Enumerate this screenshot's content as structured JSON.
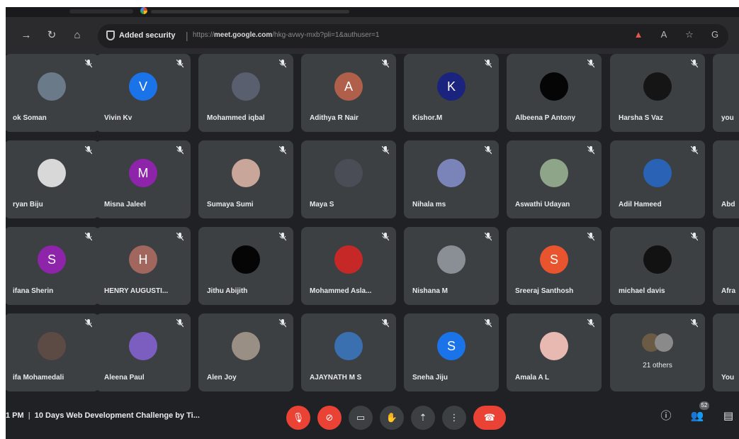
{
  "browser": {
    "security_label": "Added security",
    "url_domain": "meet.google.com",
    "url_rest": "/hkg-avwy-mxb?pli=1&authuser=1",
    "url_prefix": "https://"
  },
  "participants": [
    {
      "name": "ok Soman",
      "avatar": "photo",
      "color": "#6b7a88"
    },
    {
      "name": "Vivin Kv",
      "avatar": "letter",
      "letter": "V",
      "color": "#1a73e8"
    },
    {
      "name": "Mohammed iqbal",
      "avatar": "photo",
      "color": "#5a5f70"
    },
    {
      "name": "Adithya R Nair",
      "avatar": "letter",
      "letter": "A",
      "color": "#b0604a"
    },
    {
      "name": "Kishor.M",
      "avatar": "letter",
      "letter": "K",
      "color": "#1a237e"
    },
    {
      "name": "Albeena P Antony",
      "avatar": "photo",
      "color": "#050505"
    },
    {
      "name": "Harsha S Vaz",
      "avatar": "photo",
      "color": "#151515"
    },
    {
      "name": "you",
      "avatar": "none",
      "color": "#3c4043"
    },
    {
      "name": "ryan Biju",
      "avatar": "photo",
      "color": "#d8d8d8"
    },
    {
      "name": "Misna Jaleel",
      "avatar": "letter",
      "letter": "M",
      "color": "#8e24aa"
    },
    {
      "name": "Sumaya Sumi",
      "avatar": "photo",
      "color": "#c9a69a"
    },
    {
      "name": "Maya S",
      "avatar": "photo",
      "color": "#4a4d55"
    },
    {
      "name": "Nihala ms",
      "avatar": "photo",
      "color": "#7b84b8"
    },
    {
      "name": "Aswathi Udayan",
      "avatar": "photo",
      "color": "#8fa58a"
    },
    {
      "name": "Adil Hameed",
      "avatar": "photo",
      "color": "#2a63b5"
    },
    {
      "name": "Abd",
      "avatar": "none",
      "color": "#3c4043"
    },
    {
      "name": "ifana Sherin",
      "avatar": "letter",
      "letter": "S",
      "color": "#8e24aa"
    },
    {
      "name": "HENRY AUGUSTI...",
      "avatar": "letter",
      "letter": "H",
      "color": "#a1665e"
    },
    {
      "name": "Jithu Abijith",
      "avatar": "photo",
      "color": "#050505"
    },
    {
      "name": "Mohammed Asla...",
      "avatar": "photo",
      "color": "#c62828"
    },
    {
      "name": "Nishana M",
      "avatar": "photo",
      "color": "#8a8f95"
    },
    {
      "name": "Sreeraj Santhosh",
      "avatar": "letter",
      "letter": "S",
      "color": "#e8542e"
    },
    {
      "name": "michael davis",
      "avatar": "photo",
      "color": "#121212"
    },
    {
      "name": "Afra",
      "avatar": "none",
      "color": "#3c4043"
    },
    {
      "name": "ifa Mohamedali",
      "avatar": "photo",
      "color": "#5c4a45"
    },
    {
      "name": "Aleena Paul",
      "avatar": "photo",
      "color": "#7b5ec0"
    },
    {
      "name": "Alen Joy",
      "avatar": "photo",
      "color": "#9a8f85"
    },
    {
      "name": "AJAYNATH M S",
      "avatar": "photo",
      "color": "#3a6fb0"
    },
    {
      "name": "Sneha Jiju",
      "avatar": "letter",
      "letter": "S",
      "color": "#1a73e8"
    },
    {
      "name": "Amala A L",
      "avatar": "photo",
      "color": "#e8b9b0"
    },
    {
      "name": "21 others",
      "avatar": "others",
      "color": "#3c4043"
    },
    {
      "name": "You",
      "avatar": "none",
      "color": "#3c4043"
    }
  ],
  "meeting": {
    "time": "1 PM",
    "title": "10 Days Web Development Challenge by Ti..."
  },
  "controls": [
    {
      "name": "mic-off-button",
      "icon": "🎙",
      "style": "red"
    },
    {
      "name": "camera-off-button",
      "icon": "⊘",
      "style": "red"
    },
    {
      "name": "captions-button",
      "icon": "▭",
      "style": "dark"
    },
    {
      "name": "raise-hand-button",
      "icon": "✋",
      "style": "dark"
    },
    {
      "name": "present-button",
      "icon": "⇡",
      "style": "dark"
    },
    {
      "name": "more-options-button",
      "icon": "⋮",
      "style": "dark"
    },
    {
      "name": "leave-call-button",
      "icon": "☎",
      "style": "leave"
    }
  ],
  "side": {
    "info_icon": "ⓘ",
    "people_icon": "👥",
    "people_count": "52",
    "chat_icon": "▤"
  }
}
